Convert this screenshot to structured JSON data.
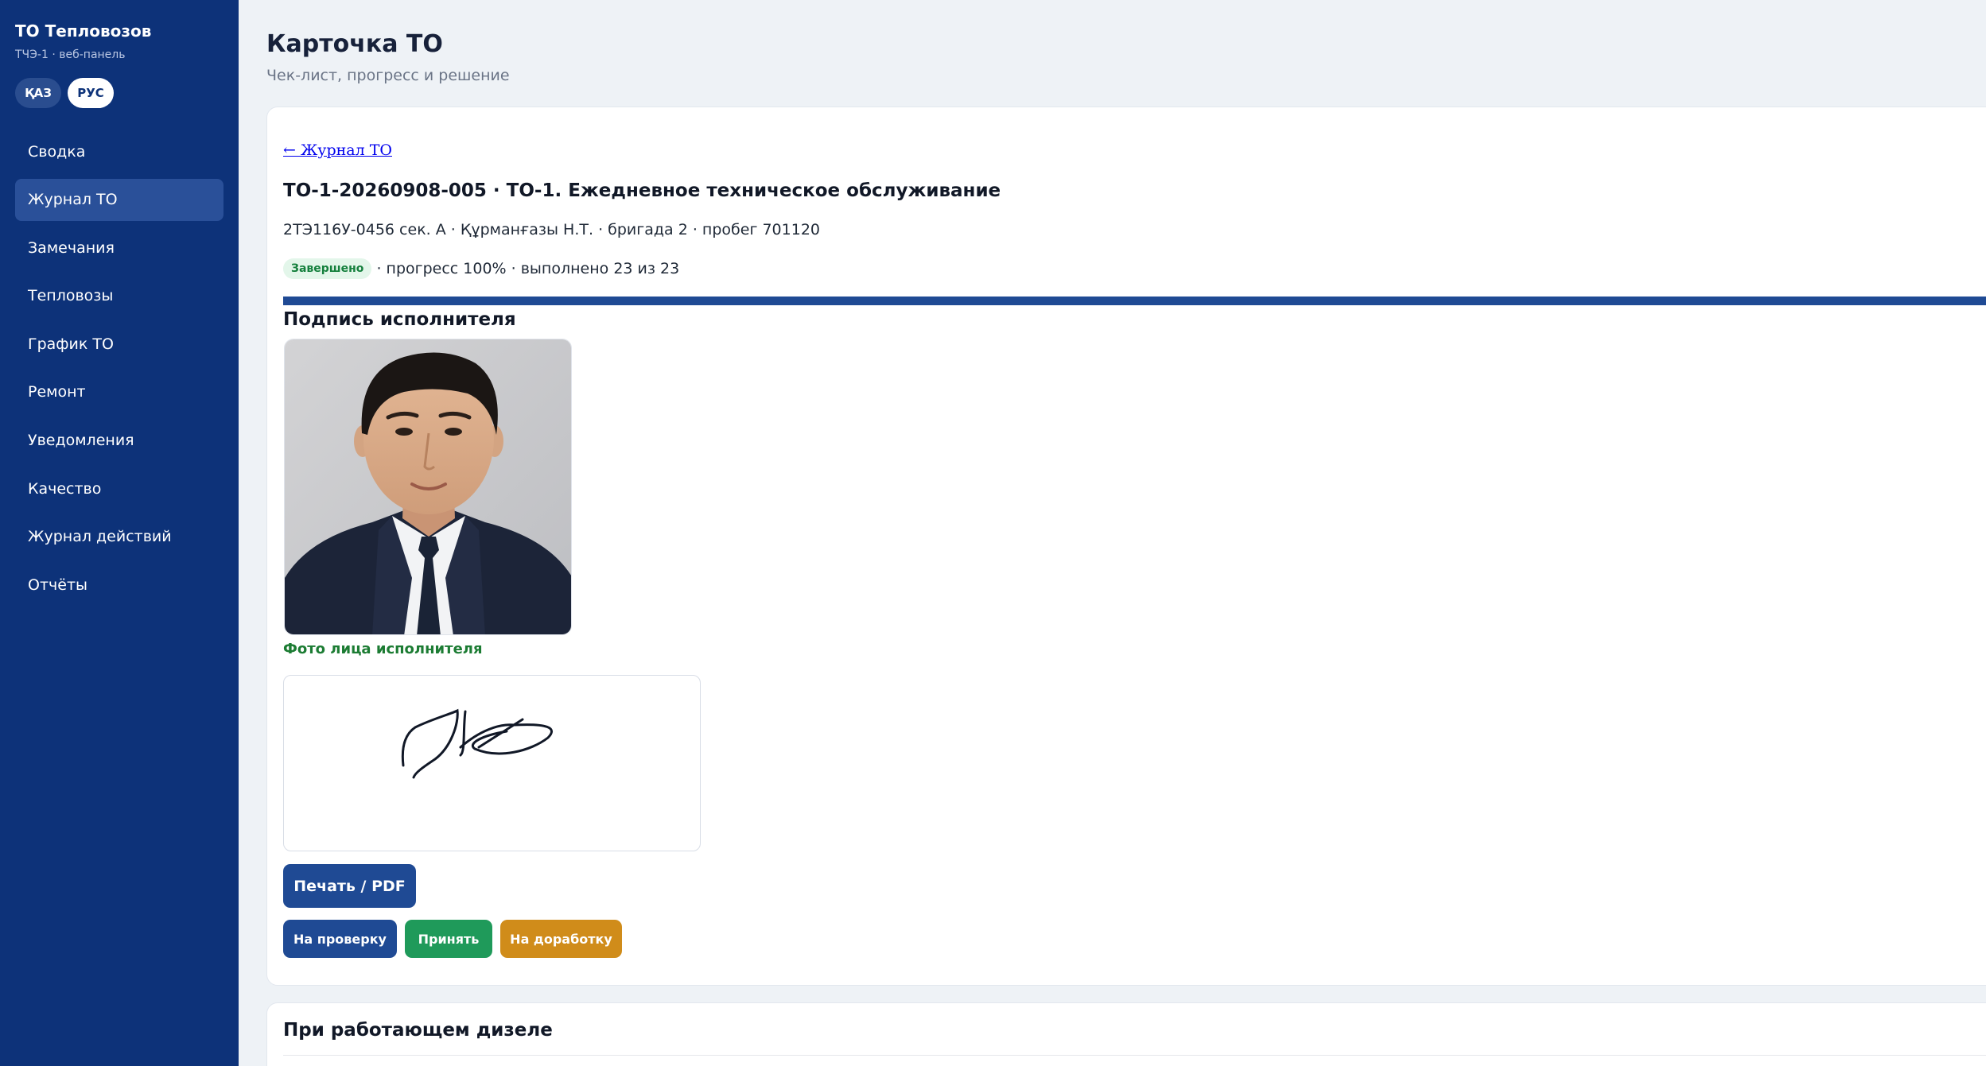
{
  "sidebar": {
    "brand_title": "ТО Тепловозов",
    "brand_subtitle": "ТЧЭ-1 · веб-панель",
    "languages": [
      "ҚАЗ",
      "РУС"
    ],
    "active_language": "РУС",
    "items": [
      {
        "label": "Сводка"
      },
      {
        "label": "Журнал ТО"
      },
      {
        "label": "Замечания"
      },
      {
        "label": "Тепловозы"
      },
      {
        "label": "График ТО"
      },
      {
        "label": "Ремонт"
      },
      {
        "label": "Уведомления"
      },
      {
        "label": "Качество"
      },
      {
        "label": "Журнал действий"
      },
      {
        "label": "Отчёты"
      }
    ],
    "active_item": "Журнал ТО"
  },
  "header": {
    "title": "Карточка ТО",
    "subtitle": "Чек-лист, прогресс и решение"
  },
  "card": {
    "back_link": "← Журнал ТО",
    "order_title": "ТО-1-20260908-005 · ТО-1. Ежедневное техническое обслуживание",
    "meta": "2ТЭ116У-0456 сек. А · Құрманғазы Н.Т. · бригада 2 · пробег 701120",
    "status_badge": "Завершено",
    "status_text": "· прогресс 100% · выполнено 23 из 23",
    "progress_percent": 100,
    "signature_heading": "Подпись исполнителя",
    "photo_caption": "Фото лица исполнителя",
    "buttons": {
      "print": "Печать / PDF",
      "review": "На проверку",
      "accept": "Принять",
      "rework": "На доработку"
    }
  },
  "section2": {
    "title": "При работающем дизеле"
  },
  "colors": {
    "sidebar_bg": "#0d3279",
    "primary": "#1f4a94",
    "success": "#1f9a5a",
    "warning": "#d08c1a",
    "caption_green": "#1c7c33"
  },
  "icons": [
    "avatar-photo",
    "signature-drawing"
  ]
}
